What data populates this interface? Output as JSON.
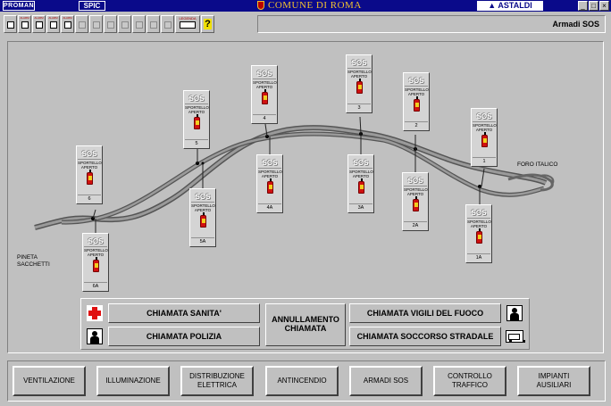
{
  "titlebar": {
    "logo_left": "PROMAN",
    "spic": "SPIC",
    "comune": "COMUNE DI ROMA",
    "astaldi": "ASTALDI",
    "window_buttons": [
      "_",
      "□",
      "×"
    ]
  },
  "toolbar": {
    "button_caps": [
      "ALARM",
      "ALARM",
      "ALARM",
      "ALARM"
    ],
    "legenda": "LEGENDA",
    "help": "?"
  },
  "section_label": "Armadi SOS",
  "sos_cabinets": [
    {
      "title": "SOS",
      "status": "SPORTELLO APERTO",
      "id": "6"
    },
    {
      "title": "SOS",
      "status": "SPORTELLO APERTO",
      "id": "6A"
    },
    {
      "title": "SOS",
      "status": "SPORTELLO APERTO",
      "id": "5"
    },
    {
      "title": "SOS",
      "status": "SPORTELLO APERTO",
      "id": "5A"
    },
    {
      "title": "SOS",
      "status": "SPORTELLO APERTO",
      "id": "4"
    },
    {
      "title": "SOS",
      "status": "SPORTELLO APERTO",
      "id": "4A"
    },
    {
      "title": "SOS",
      "status": "SPORTELLO APERTO",
      "id": "3"
    },
    {
      "title": "SOS",
      "status": "SPORTELLO APERTO",
      "id": "3A"
    },
    {
      "title": "SOS",
      "status": "SPORTELLO APERTO",
      "id": "2"
    },
    {
      "title": "SOS",
      "status": "SPORTELLO APERTO",
      "id": "2A"
    },
    {
      "title": "SOS",
      "status": "SPORTELLO APERTO",
      "id": "1"
    },
    {
      "title": "SOS",
      "status": "SPORTELLO APERTO",
      "id": "1A"
    }
  ],
  "places": {
    "west_line1": "PINETA",
    "west_line2": "SACCHETTI",
    "east": "FORO ITALICO"
  },
  "calls": {
    "sanita": "CHIAMATA SANITA'",
    "polizia": "CHIAMATA POLIZIA",
    "annullamento_line1": "ANNULLAMENTO",
    "annullamento_line2": "CHIAMATA",
    "vigili": "CHIAMATA VIGILI DEL FUOCO",
    "soccorso": "CHIAMATA SOCCORSO STRADALE"
  },
  "nav": [
    "VENTILAZIONE",
    "ILLUMINAZIONE",
    "DISTRIBUZIONE ELETTRICA",
    "ANTINCENDIO",
    "ARMADI SOS",
    "CONTROLLO TRAFFICO",
    "IMPIANTI AUSILIARI"
  ],
  "colors": {
    "titlebar": "#0a0a8a",
    "comune_text": "#f0c030",
    "panel_bg": "#c0c0c0",
    "extinguisher": "#d01010"
  }
}
